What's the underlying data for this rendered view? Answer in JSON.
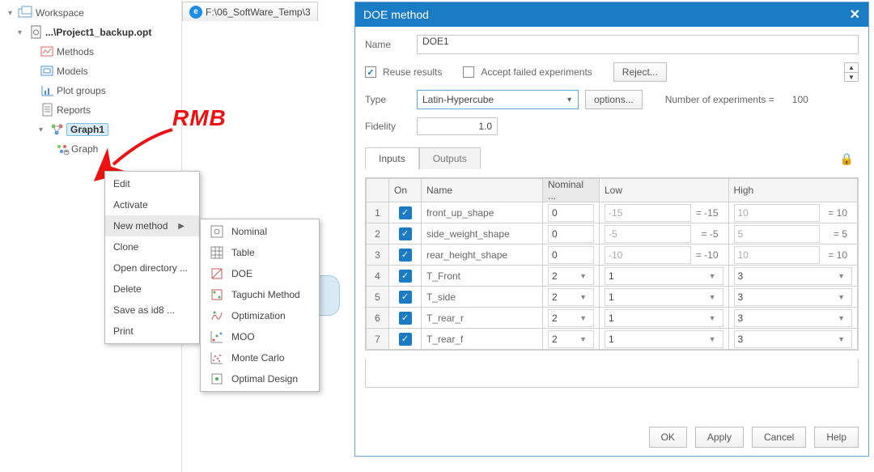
{
  "tree": {
    "root": "Workspace",
    "project": "...\\Project1_backup.opt",
    "items": [
      "Methods",
      "Models",
      "Plot groups",
      "Reports"
    ],
    "selected": "Graph1",
    "child": "Graph"
  },
  "tab": {
    "title": "F:\\06_SoftWare_Temp\\3"
  },
  "annotation": {
    "rmb": "RMB"
  },
  "menu1": {
    "items": [
      "Edit",
      "Activate",
      "New method",
      "Clone",
      "Open directory ...",
      "Delete",
      "Save as id8 ...",
      "Print"
    ]
  },
  "menu2": {
    "items": [
      "Nominal",
      "Table",
      "DOE",
      "Taguchi Method",
      "Optimization",
      "MOO",
      "Monte Carlo",
      "Optimal Design"
    ]
  },
  "dialog": {
    "title": "DOE method",
    "name_label": "Name",
    "name_value": "DOE1",
    "reuse_label": "Reuse results",
    "accept_label": "Accept failed experiments",
    "reject_label": "Reject...",
    "type_label": "Type",
    "type_value": "Latin-Hypercube",
    "options_label": "options...",
    "num_exp_label": "Number of experiments =",
    "num_exp_value": "100",
    "fidelity_label": "Fidelity",
    "fidelity_value": "1.0",
    "tabs": {
      "inputs": "Inputs",
      "outputs": "Outputs"
    },
    "columns": {
      "on": "On",
      "name": "Name",
      "nominal": "Nominal ...",
      "low": "Low",
      "high": "High"
    },
    "rows": [
      {
        "idx": "1",
        "name": "front_up_shape",
        "nominal": "0",
        "nominal_combo": false,
        "low": "-15",
        "low_ghost": true,
        "loweq": "-15",
        "high": "10",
        "high_ghost": true,
        "higheq": "10"
      },
      {
        "idx": "2",
        "name": "side_weight_shape",
        "nominal": "0",
        "nominal_combo": false,
        "low": "-5",
        "low_ghost": true,
        "loweq": "-5",
        "high": "5",
        "high_ghost": true,
        "higheq": "5"
      },
      {
        "idx": "3",
        "name": "rear_height_shape",
        "nominal": "0",
        "nominal_combo": false,
        "low": "-10",
        "low_ghost": true,
        "loweq": "-10",
        "high": "10",
        "high_ghost": true,
        "higheq": "10"
      },
      {
        "idx": "4",
        "name": "T_Front",
        "nominal": "2",
        "nominal_combo": true,
        "low": "1",
        "low_ghost": false,
        "loweq": "",
        "high": "3",
        "high_ghost": false,
        "higheq": ""
      },
      {
        "idx": "5",
        "name": "T_side",
        "nominal": "2",
        "nominal_combo": true,
        "low": "1",
        "low_ghost": false,
        "loweq": "",
        "high": "3",
        "high_ghost": false,
        "higheq": ""
      },
      {
        "idx": "6",
        "name": "T_rear_r",
        "nominal": "2",
        "nominal_combo": true,
        "low": "1",
        "low_ghost": false,
        "loweq": "",
        "high": "3",
        "high_ghost": false,
        "higheq": ""
      },
      {
        "idx": "7",
        "name": "T_rear_f",
        "nominal": "2",
        "nominal_combo": true,
        "low": "1",
        "low_ghost": false,
        "loweq": "",
        "high": "3",
        "high_ghost": false,
        "higheq": ""
      }
    ],
    "buttons": {
      "ok": "OK",
      "apply": "Apply",
      "cancel": "Cancel",
      "help": "Help"
    }
  }
}
